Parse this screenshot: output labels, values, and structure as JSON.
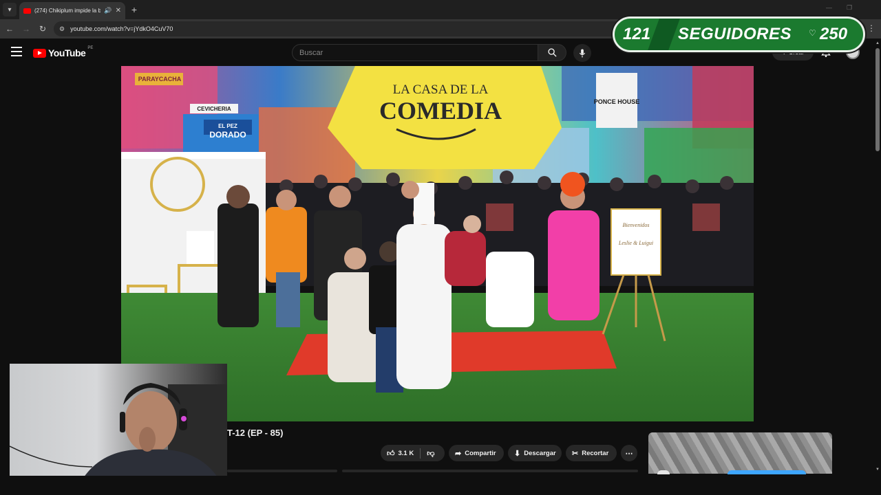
{
  "browser": {
    "tab_title": "(274) Chikiplum impide la b",
    "url": "youtube.com/watch?v=jYdkO4CuV70"
  },
  "youtube": {
    "logo_text": "YouTube",
    "region": "PE",
    "search_placeholder": "Buscar",
    "create_label": "Crear",
    "notification_badge": "9+"
  },
  "overlay": {
    "followers_count": "121",
    "followers_label": "SEGUIDORES",
    "followers_goal": "250",
    "colors": {
      "bg": "#1b7a2f",
      "stripe": "#0f5a22"
    }
  },
  "player": {
    "banner_line1": "LA CASA DE LA",
    "banner_line2": "COMEDIA",
    "sign_left": "DORADO",
    "sign_left_top": "EL PEZ",
    "sign_cevicheria": "CEVICHERIA",
    "sign_paraycacha": "PARAYCACHA",
    "sign_ponce": "PONCE HOUSE",
    "sign_welcome": "Bienvenidos",
    "sign_names": "Leslie & Luigui"
  },
  "video": {
    "title": "T-12 (EP - 85)",
    "like_count": "3.1 K",
    "share_label": "Compartir",
    "download_label": "Descargar",
    "clip_label": "Recortar"
  }
}
